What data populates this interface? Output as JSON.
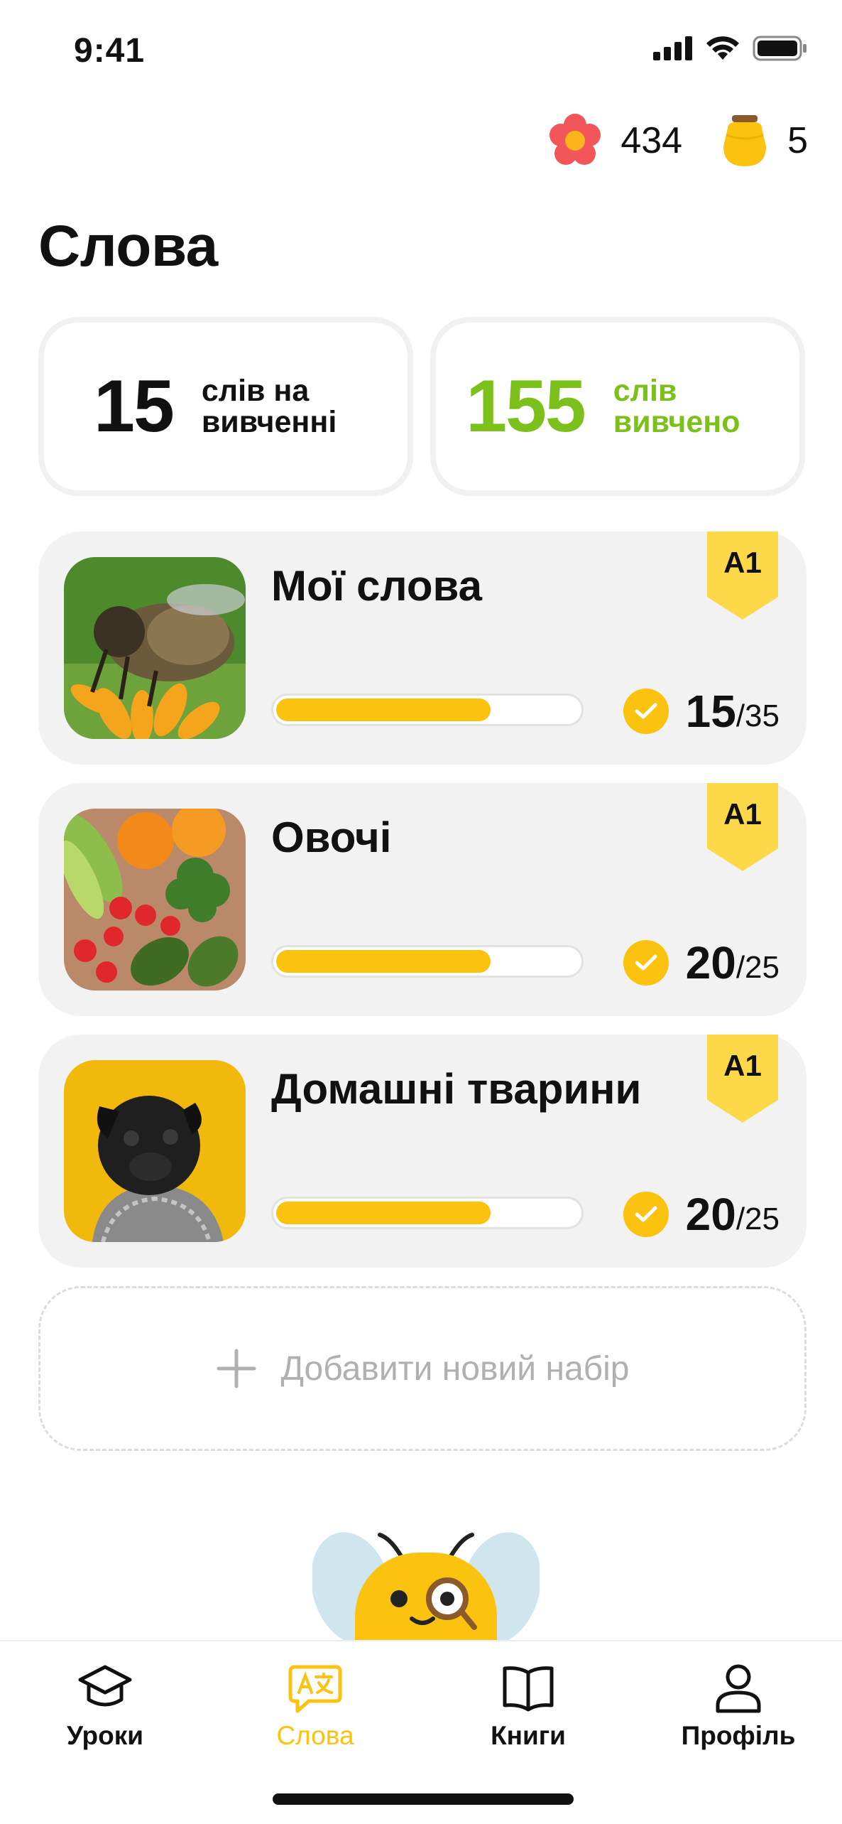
{
  "status_bar": {
    "time": "9:41"
  },
  "counters": {
    "flowers": {
      "icon": "flower-icon",
      "value": "434"
    },
    "honey": {
      "icon": "honey-jar-icon",
      "value": "5"
    }
  },
  "page": {
    "title": "Слова"
  },
  "stats": {
    "learning": {
      "number": "15",
      "label": "слів на вивченні"
    },
    "learned": {
      "number": "155",
      "label": "слів вивчено",
      "color": "#7cc11b"
    }
  },
  "sets": [
    {
      "title": "Мої слова",
      "level": "A1",
      "done": "15",
      "total": "/35",
      "progress": 0.71,
      "image": "bee-photo"
    },
    {
      "title": "Овочі",
      "level": "A1",
      "done": "20",
      "total": "/25",
      "progress": 0.71,
      "image": "vegetables-photo"
    },
    {
      "title": "Домашні тварини",
      "level": "A1",
      "done": "20",
      "total": "/25",
      "progress": 0.71,
      "image": "pug-photo"
    }
  ],
  "add_set": {
    "label": "Добавити новий набір",
    "icon": "plus-icon"
  },
  "tabs": [
    {
      "label": "Уроки",
      "icon": "graduation-cap-icon",
      "active": false
    },
    {
      "label": "Слова",
      "icon": "translate-bubble-icon",
      "active": true
    },
    {
      "label": "Книги",
      "icon": "book-icon",
      "active": false
    },
    {
      "label": "Профіль",
      "icon": "person-icon",
      "active": false
    }
  ],
  "colors": {
    "accent": "#fbc310",
    "success": "#7cc11b",
    "card_bg": "#f2f2f2"
  }
}
